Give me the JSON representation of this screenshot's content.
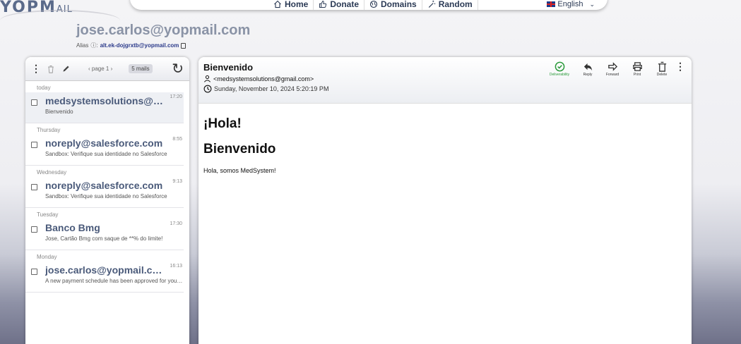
{
  "logo": {
    "text": "YOPM",
    "suffix": "AIL"
  },
  "nav": {
    "items": [
      {
        "label": "Home",
        "icon": "home-icon"
      },
      {
        "label": "Donate",
        "icon": "thumbs-up-icon"
      },
      {
        "label": "Domains",
        "icon": "globe-icon"
      },
      {
        "label": "Random",
        "icon": "magic-wand-icon"
      }
    ],
    "language": "English"
  },
  "account": {
    "email": "jose.carlos@yopmail.com",
    "alias_label": "Alias",
    "alias_address": "alt.ek-dojgrxtb@yopmail.com"
  },
  "list": {
    "pager": "‹ page 1 ›",
    "count": "5 mails",
    "groups": [
      {
        "day": "today",
        "mails": [
          {
            "from": "medsystemsolutions@gmail.com",
            "time": "17:20",
            "subject": "Bienvenido",
            "selected": true
          }
        ]
      },
      {
        "day": "Thursday",
        "mails": [
          {
            "from": "noreply@salesforce.com",
            "time": "8:55",
            "subject": "Sandbox: Verifique sua identidade no Salesforce"
          }
        ]
      },
      {
        "day": "Wednesday",
        "mails": [
          {
            "from": "noreply@salesforce.com",
            "time": "9:13",
            "subject": "Sandbox: Verifique sua identidade no Salesforce"
          }
        ]
      },
      {
        "day": "Tuesday",
        "mails": [
          {
            "from": "Banco Bmg",
            "time": "17:30",
            "subject": "Jose, Cartão Bmg com saque de **% do limite!"
          }
        ]
      },
      {
        "day": "Monday",
        "mails": [
          {
            "from": "jose.carlos@yopmail.com",
            "time": "16:13",
            "subject": "A new payment schedule has been approved for your account"
          }
        ]
      }
    ]
  },
  "mail": {
    "subject": "Bienvenido",
    "from": "<medsystemsolutions@gmail.com>",
    "date": "Sunday, November 10, 2024 5:20:19 PM",
    "actions": {
      "deliverability": "Deliverability",
      "reply": "Reply",
      "forward": "Forward",
      "print": "Print",
      "delete": "Delete"
    },
    "body": {
      "heading1": "¡Hola!",
      "heading2": "Bienvenido",
      "text": "Hola, somos MedSystem!"
    }
  },
  "colors": {
    "accent": "#2b3a55",
    "deliverability": "#2a9a3a"
  }
}
